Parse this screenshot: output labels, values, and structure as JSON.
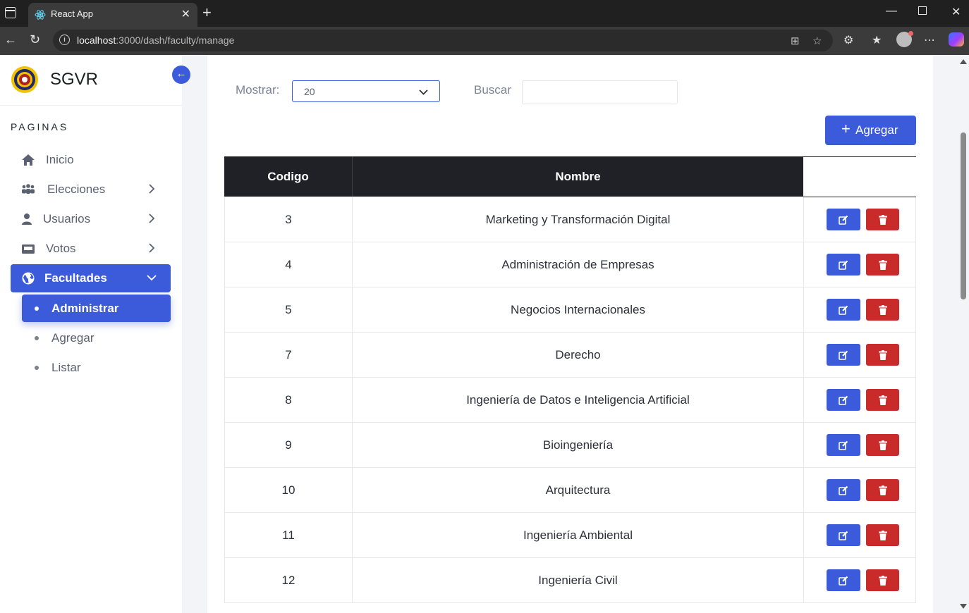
{
  "browser": {
    "tab_title": "React App",
    "url_host": "localhost",
    "url_rest": ":3000/dash/faculty/manage"
  },
  "sidebar": {
    "brand": "SGVR",
    "section_title": "PAGINAS",
    "items": [
      {
        "label": "Inicio"
      },
      {
        "label": "Elecciones"
      },
      {
        "label": "Usuarios"
      },
      {
        "label": "Votos"
      },
      {
        "label": "Facultades"
      }
    ],
    "sub_items": [
      {
        "label": "Administrar"
      },
      {
        "label": "Agregar"
      },
      {
        "label": "Listar"
      }
    ]
  },
  "controls": {
    "show_label": "Mostrar:",
    "show_value": "20",
    "search_label": "Buscar",
    "search_value": "",
    "add_label": "Agregar"
  },
  "table": {
    "headers": [
      "Codigo",
      "Nombre"
    ],
    "rows": [
      {
        "code": "3",
        "name": "Marketing y Transformación Digital"
      },
      {
        "code": "4",
        "name": "Administración de Empresas"
      },
      {
        "code": "5",
        "name": "Negocios Internacionales"
      },
      {
        "code": "7",
        "name": "Derecho"
      },
      {
        "code": "8",
        "name": "Ingeniería de Datos e Inteligencia Artificial"
      },
      {
        "code": "9",
        "name": "Bioingeniería"
      },
      {
        "code": "10",
        "name": "Arquitectura"
      },
      {
        "code": "11",
        "name": "Ingeniería Ambiental"
      },
      {
        "code": "12",
        "name": "Ingeniería Civil"
      }
    ]
  },
  "colors": {
    "primary": "#3b5bdb",
    "danger": "#c92a2a",
    "table_header": "#1f2126"
  }
}
